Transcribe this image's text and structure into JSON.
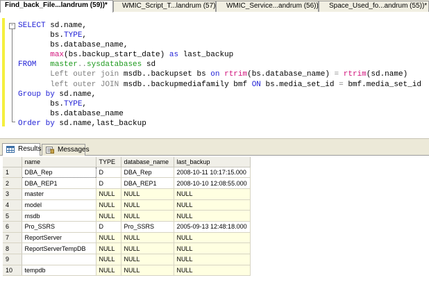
{
  "tabs": [
    {
      "label": "Find_back_File...landrum (59))*",
      "active": true
    },
    {
      "label": "WMIC_Script_T...landrum (57))",
      "active": false
    },
    {
      "label": "WMIC_Service...andrum (56))*",
      "active": false
    },
    {
      "label": "Space_Used_fo...andrum (55))*",
      "active": false
    }
  ],
  "outline_toggle": "-",
  "sql": {
    "l1": {
      "kw": "SELECT",
      "rest": " sd.name,"
    },
    "l2": {
      "pre": "       bs.",
      "kw": "TYPE",
      "rest": ","
    },
    "l3": {
      "text": "       bs.database_name,"
    },
    "l4": {
      "fn": "max",
      "a": "(bs.backup_start_date) ",
      "kw": "as",
      "b": " last_backup"
    },
    "l5": {
      "kw": "FROM",
      "pre": "   ",
      "sys": "master",
      "gr": "..",
      "sys2": "sysdatabases",
      "rest": " sd"
    },
    "l6": {
      "g1": "Left outer join",
      "t1": " msdb..backupset bs ",
      "k1": "on",
      "t2": " ",
      "f1": "rtrim",
      "t3": "(bs.database_name) ",
      "g2": "=",
      "t4": " ",
      "f2": "rtrim",
      "t5": "(sd.name)"
    },
    "l7": {
      "g1": "left outer JOIN",
      "t1": " msdb..backupmediafamily bmf ",
      "k1": "ON",
      "t2": " bs.media_set_id ",
      "g2": "=",
      "t3": " bmf.media_set_id"
    },
    "l8": {
      "kw": "Group by",
      "rest": " sd.name,"
    },
    "l9": {
      "pre": "       bs.",
      "kw": "TYPE",
      "rest": ","
    },
    "l10": {
      "text": "       bs.database_name"
    },
    "l11": {
      "kw": "Order by",
      "rest": " sd.name,last_backup"
    }
  },
  "results_tabs": [
    {
      "label": "Results",
      "icon": "grid-icon",
      "active": true
    },
    {
      "label": "Messages",
      "icon": "messages-icon",
      "active": false
    }
  ],
  "grid": {
    "columns": [
      "name",
      "TYPE",
      "database_name",
      "last_backup"
    ],
    "rows": [
      {
        "n": "1",
        "name": "DBA_Rep",
        "type": "D",
        "db": "DBA_Rep",
        "last": "2008-10-11 10:17:15.000"
      },
      {
        "n": "2",
        "name": "DBA_REP1",
        "type": "D",
        "db": "DBA_REP1",
        "last": "2008-10-10 12:08:55.000"
      },
      {
        "n": "3",
        "name": "master",
        "type": "NULL",
        "db": "NULL",
        "last": "NULL"
      },
      {
        "n": "4",
        "name": "model",
        "type": "NULL",
        "db": "NULL",
        "last": "NULL"
      },
      {
        "n": "5",
        "name": "msdb",
        "type": "NULL",
        "db": "NULL",
        "last": "NULL"
      },
      {
        "n": "6",
        "name": "Pro_SSRS",
        "type": "D",
        "db": "Pro_SSRS",
        "last": "2005-09-13 12:48:18.000"
      },
      {
        "n": "7",
        "name": "ReportServer",
        "type": "NULL",
        "db": "NULL",
        "last": "NULL"
      },
      {
        "n": "8",
        "name": "ReportServerTempDB",
        "type": "NULL",
        "db": "NULL",
        "last": "NULL"
      },
      {
        "n": "9",
        "name": "",
        "type": "NULL",
        "db": "NULL",
        "last": "NULL"
      },
      {
        "n": "10",
        "name": "tempdb",
        "type": "NULL",
        "db": "NULL",
        "last": "NULL"
      }
    ]
  },
  "colors": {
    "keyword": "#1f1fd6",
    "function": "#d1107a",
    "system_object": "#1d9a1d",
    "operator": "#808080",
    "cell_null_bg": "#ffffe1",
    "change_bar": "#f5ef3e"
  }
}
